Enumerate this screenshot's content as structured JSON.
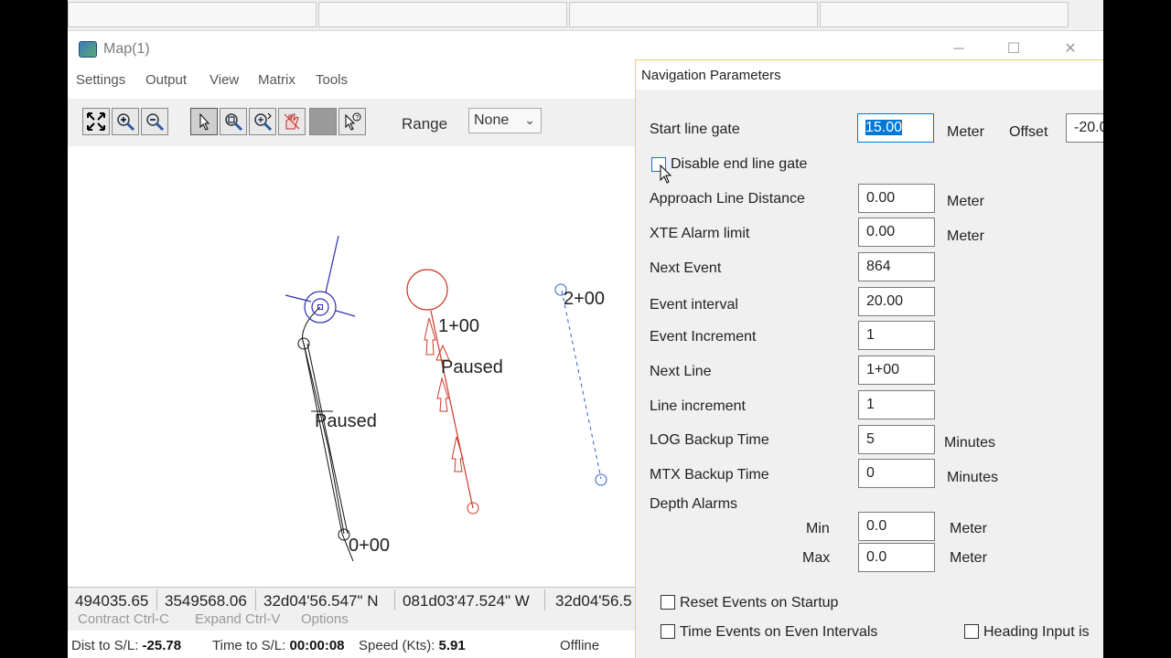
{
  "map_window": {
    "title": "Map(1)",
    "menu": [
      "Settings",
      "Output",
      "View",
      "Matrix",
      "Tools"
    ],
    "toolbar": {
      "range_label": "Range",
      "range_value": "None",
      "buttons": [
        "zoom-extents-icon",
        "zoom-in-icon",
        "zoom-out-icon",
        "select-arrow-icon",
        "zoom-window-icon",
        "zoom-dynamic-icon",
        "pan-hand-icon",
        "blank-tool-icon",
        "info-arrow-icon"
      ]
    },
    "map_labels": {
      "line0_paused": "Paused",
      "line0_station": "0+00",
      "line1_station": "1+00",
      "line1_paused": "Paused",
      "line2_station": "2+00"
    },
    "status_cells": [
      "494035.65",
      "3549568.06",
      "32d04'56.547\" N",
      "081d03'47.524\" W",
      "32d04'56.5"
    ],
    "bottom_menu": [
      "Contract Ctrl-C",
      "Expand Ctrl-V",
      "Options"
    ],
    "info": {
      "dist_label": "Dist to S/L:",
      "dist_value": "-25.78",
      "time_label": "Time to S/L:",
      "time_value": "00:00:08",
      "speed_label": "Speed (Kts):",
      "speed_value": "5.91",
      "state": "Offline"
    }
  },
  "dialog": {
    "title": "Navigation Parameters",
    "start_line_gate": {
      "label": "Start line gate",
      "value": "15.00",
      "unit": "Meter",
      "offset_label": "Offset",
      "offset_value": "-20.0"
    },
    "disable_end_gate": {
      "label": "Disable end line gate",
      "checked": false
    },
    "fields": [
      {
        "label": "Approach Line Distance",
        "value": "0.00",
        "unit": "Meter"
      },
      {
        "label": "XTE Alarm limit",
        "value": "0.00",
        "unit": "Meter"
      },
      {
        "label": "Next Event",
        "value": "864",
        "unit": ""
      },
      {
        "label": "Event interval",
        "value": "20.00",
        "unit": ""
      },
      {
        "label": "Event Increment",
        "value": "1",
        "unit": ""
      },
      {
        "label": "Next Line",
        "value": "1+00",
        "unit": ""
      },
      {
        "label": "Line increment",
        "value": "1",
        "unit": ""
      },
      {
        "label": "LOG Backup Time",
        "value": "5",
        "unit": "Minutes"
      },
      {
        "label": "MTX Backup Time",
        "value": "0",
        "unit": "Minutes"
      }
    ],
    "depth_alarms": {
      "label": "Depth Alarms",
      "min_label": "Min",
      "min_value": "0.0",
      "min_unit": "Meter",
      "max_label": "Max",
      "max_value": "0.0",
      "max_unit": "Meter"
    },
    "checkboxes": {
      "reset_events": "Reset Events on Startup",
      "time_events": "Time Events on Even Intervals",
      "heading_input": "Heading Input is"
    }
  },
  "colors": {
    "track_black": "#111111",
    "track_red": "#cc3a2a",
    "track_blue": "#2a60c8",
    "boat_blue": "#2d2db0",
    "selection": "#0078d7"
  }
}
